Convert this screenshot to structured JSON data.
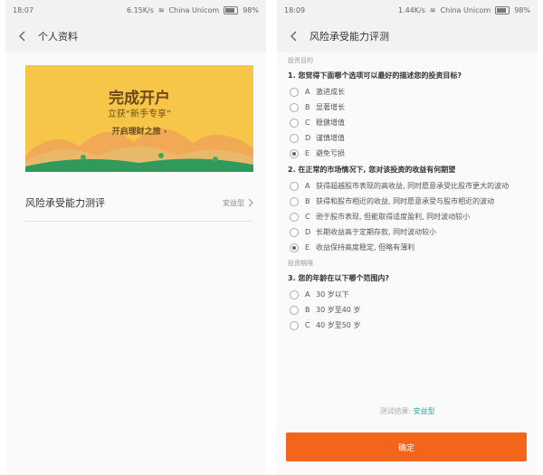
{
  "left": {
    "status": {
      "time": "18:07",
      "speed": "6.15K/s",
      "carrier": "China Unicom",
      "battery": "98%"
    },
    "title": "个人资料",
    "banner": {
      "title": "完成开户",
      "subtitle": "立获“新手专享”",
      "cta": "开启理财之旅"
    },
    "risk_row": {
      "label": "风险承受能力测评",
      "value": "安益型"
    }
  },
  "right": {
    "status": {
      "time": "18:09",
      "speed": "1.44K/s",
      "carrier": "China Unicom",
      "battery": "98%"
    },
    "title": "风险承受能力评测",
    "sections": [
      {
        "label": "投资目的",
        "questions": [
          {
            "title": "1. 您觉得下面哪个选项可以最好的描述您的投资目标?",
            "options": [
              {
                "letter": "A",
                "text": "激进成长",
                "checked": false
              },
              {
                "letter": "B",
                "text": "显著增长",
                "checked": false
              },
              {
                "letter": "C",
                "text": "稳健增值",
                "checked": false
              },
              {
                "letter": "D",
                "text": "谨慎增值",
                "checked": false
              },
              {
                "letter": "E",
                "text": "避免亏损",
                "checked": true
              }
            ]
          },
          {
            "title": "2. 在正常的市场情况下, 您对该投资的收益有何期望",
            "options": [
              {
                "letter": "A",
                "text": "获得超越股市表现的高收益, 同时愿意承受比股市更大的波动",
                "checked": false
              },
              {
                "letter": "B",
                "text": "获得和股市相近的收益, 同时愿意承受与股市相近的波动",
                "checked": false
              },
              {
                "letter": "C",
                "text": "逊于股市表现, 但能取得适度盈利, 同时波动较小",
                "checked": false
              },
              {
                "letter": "D",
                "text": "长期收益高于定期存款, 同时波动较小",
                "checked": false
              },
              {
                "letter": "E",
                "text": "收益保持高度稳定, 但略有薄利",
                "checked": true
              }
            ]
          }
        ]
      },
      {
        "label": "投资期限",
        "questions": [
          {
            "title": "3. 您的年龄在以下哪个范围内?",
            "options": [
              {
                "letter": "A",
                "text": "30 岁以下",
                "checked": false
              },
              {
                "letter": "B",
                "text": "30 岁至40 岁",
                "checked": false
              },
              {
                "letter": "C",
                "text": "40 岁至50 岁",
                "checked": false
              }
            ]
          }
        ]
      }
    ],
    "result": {
      "label": "测试结果:",
      "value": "安益型"
    },
    "confirm_label": "确定"
  },
  "colors": {
    "accent": "#f4651c",
    "banner_bg": "#f7c648",
    "result": "#2ba0a0"
  }
}
